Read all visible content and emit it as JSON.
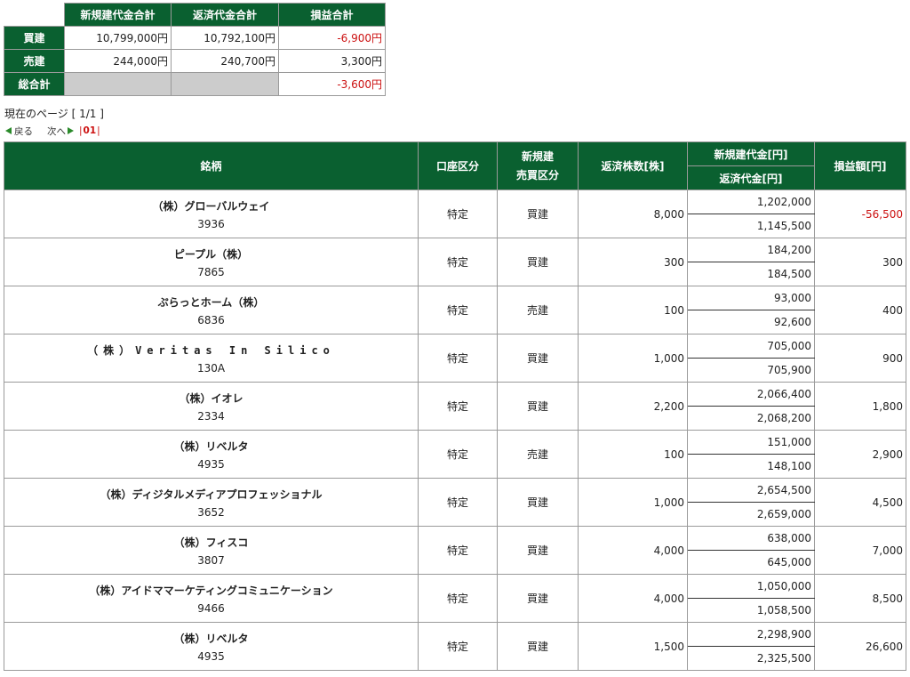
{
  "summary": {
    "headers": [
      "新規建代金合計",
      "返済代金合計",
      "損益合計"
    ],
    "rows": [
      {
        "label": "買建",
        "new_total": "10,799,000円",
        "repay_total": "10,792,100円",
        "pl_total": "-6,900円",
        "pl_negative": true
      },
      {
        "label": "売建",
        "new_total": "244,000円",
        "repay_total": "240,700円",
        "pl_total": "3,300円",
        "pl_negative": false
      },
      {
        "label": "総合計",
        "new_total": "",
        "repay_total": "",
        "pl_total": "-3,600円",
        "pl_negative": true
      }
    ]
  },
  "page_info": "現在のページ [ 1/1 ]",
  "pager": {
    "prev": "戻る",
    "next": "次へ",
    "current": "01"
  },
  "table": {
    "headers": {
      "name": "銘柄",
      "account": "口座区分",
      "side_line1": "新規建",
      "side_line2": "売買区分",
      "qty": "返済株数[株]",
      "new_price": "新規建代金[円]",
      "repay_price": "返済代金[円]",
      "pl": "損益額[円]"
    },
    "rows": [
      {
        "name": "（株）グローバルウェイ",
        "code": "3936",
        "account": "特定",
        "side": "買建",
        "qty": "8,000",
        "new_price": "1,202,000",
        "repay_price": "1,145,500",
        "pl": "-56,500",
        "pl_negative": true
      },
      {
        "name": "ピープル（株）",
        "code": "7865",
        "account": "特定",
        "side": "買建",
        "qty": "300",
        "new_price": "184,200",
        "repay_price": "184,500",
        "pl": "300",
        "pl_negative": false
      },
      {
        "name": "ぷらっとホーム（株）",
        "code": "6836",
        "account": "特定",
        "side": "売建",
        "qty": "100",
        "new_price": "93,000",
        "repay_price": "92,600",
        "pl": "400",
        "pl_negative": false
      },
      {
        "name": "（株）Veritas In Silico",
        "code": "130A",
        "account": "特定",
        "side": "買建",
        "qty": "1,000",
        "new_price": "705,000",
        "repay_price": "705,900",
        "pl": "900",
        "pl_negative": false
      },
      {
        "name": "（株）イオレ",
        "code": "2334",
        "account": "特定",
        "side": "買建",
        "qty": "2,200",
        "new_price": "2,066,400",
        "repay_price": "2,068,200",
        "pl": "1,800",
        "pl_negative": false
      },
      {
        "name": "（株）リベルタ",
        "code": "4935",
        "account": "特定",
        "side": "売建",
        "qty": "100",
        "new_price": "151,000",
        "repay_price": "148,100",
        "pl": "2,900",
        "pl_negative": false
      },
      {
        "name": "（株）ディジタルメディアプロフェッショナル",
        "code": "3652",
        "account": "特定",
        "side": "買建",
        "qty": "1,000",
        "new_price": "2,654,500",
        "repay_price": "2,659,000",
        "pl": "4,500",
        "pl_negative": false
      },
      {
        "name": "（株）フィスコ",
        "code": "3807",
        "account": "特定",
        "side": "買建",
        "qty": "4,000",
        "new_price": "638,000",
        "repay_price": "645,000",
        "pl": "7,000",
        "pl_negative": false
      },
      {
        "name": "（株）アイドママーケティングコミュニケーション",
        "code": "9466",
        "account": "特定",
        "side": "買建",
        "qty": "4,000",
        "new_price": "1,050,000",
        "repay_price": "1,058,500",
        "pl": "8,500",
        "pl_negative": false
      },
      {
        "name": "（株）リベルタ",
        "code": "4935",
        "account": "特定",
        "side": "買建",
        "qty": "1,500",
        "new_price": "2,298,900",
        "repay_price": "2,325,500",
        "pl": "26,600",
        "pl_negative": false
      }
    ]
  }
}
